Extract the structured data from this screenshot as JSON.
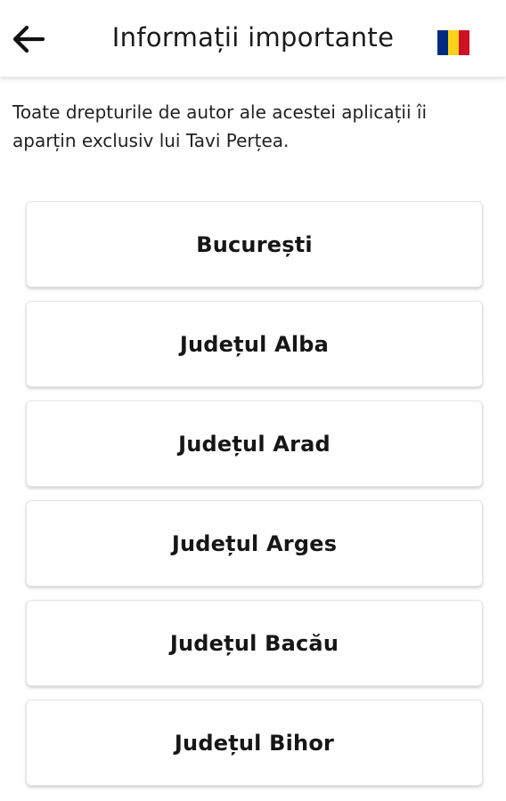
{
  "header": {
    "back_icon": "arrow-left-icon",
    "title": "Informații importante",
    "language_flag": {
      "icon": "romania-flag-icon",
      "colors": [
        "#002B7F",
        "#FCD116",
        "#CE1126"
      ]
    }
  },
  "copyright_text": "Toate drepturile de autor ale acestei aplicații îi aparțin exclusiv lui Tavi Perțea.",
  "regions": [
    {
      "label": "București"
    },
    {
      "label": "Județul Alba"
    },
    {
      "label": "Județul Arad"
    },
    {
      "label": "Județul Arges"
    },
    {
      "label": "Județul Bacău"
    },
    {
      "label": "Județul Bihor"
    }
  ]
}
